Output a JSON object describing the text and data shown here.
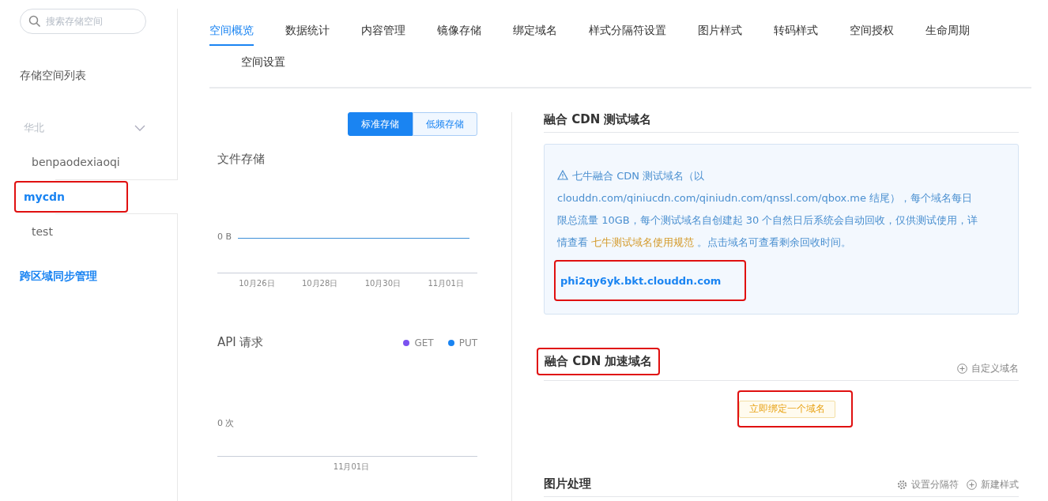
{
  "sidebar": {
    "search": {
      "placeholder": "搜索存储空间"
    },
    "heading": "存储空间列表",
    "region": {
      "label": "华北",
      "expanded": false
    },
    "buckets": [
      {
        "name": "benpaodexiaoqi",
        "selected": false,
        "highlighted": false
      },
      {
        "name": "mycdn",
        "selected": true,
        "highlighted": true
      },
      {
        "name": "test",
        "selected": false,
        "highlighted": false
      }
    ],
    "link": "跨区域同步管理"
  },
  "tabs": [
    {
      "label": "空间概览",
      "selected": true
    },
    {
      "label": "数据统计",
      "selected": false
    },
    {
      "label": "内容管理",
      "selected": false
    },
    {
      "label": "镜像存储",
      "selected": false
    },
    {
      "label": "绑定域名",
      "selected": false
    },
    {
      "label": "样式分隔符设置",
      "selected": false
    },
    {
      "label": "图片样式",
      "selected": false
    },
    {
      "label": "转码样式",
      "selected": false
    },
    {
      "label": "空间授权",
      "selected": false
    },
    {
      "label": "生命周期",
      "selected": false
    },
    {
      "label": "空间设置",
      "selected": false
    }
  ],
  "storage_toggle": [
    {
      "label": "标准存储",
      "selected": true
    },
    {
      "label": "低频存储",
      "selected": false
    }
  ],
  "file_storage": {
    "title": "文件存储",
    "y_label": "0 B",
    "x_labels": [
      "10月26日",
      "10月28日",
      "10月30日",
      "11月01日"
    ]
  },
  "api_requests": {
    "title": "API 请求",
    "legend": [
      {
        "label": "GET",
        "color": "#7b52f0"
      },
      {
        "label": "PUT",
        "color": "#1a84f2"
      }
    ],
    "y_label": "0 次",
    "x_labels": [
      "11月01日"
    ]
  },
  "test_domain": {
    "title": "融合 CDN 测试域名",
    "notice_before": "七牛融合 CDN 测试域名（以 clouddn.com/qiniucdn.com/qiniudn.com/qnssl.com/qbox.me 结尾），每个域名每日限总流量 10GB，每个测试域名自创建起 30 个自然日后系统会自动回收，仅供测试使用，详情查看 ",
    "notice_link": "七牛测试域名使用规范",
    "notice_after": " 。点击域名可查看剩余回收时间。",
    "domain": "phi2qy6yk.bkt.clouddn.com",
    "domain_highlighted": true
  },
  "accel_domain": {
    "title": "融合 CDN 加速域名",
    "title_highlighted": true,
    "action": "自定义域名",
    "bind_button": "立即绑定一个域名",
    "bind_highlighted": true
  },
  "image_processing": {
    "title": "图片处理",
    "actions": [
      {
        "label": "设置分隔符",
        "kind": "settings"
      },
      {
        "label": "新建样式",
        "kind": "add"
      }
    ]
  }
}
